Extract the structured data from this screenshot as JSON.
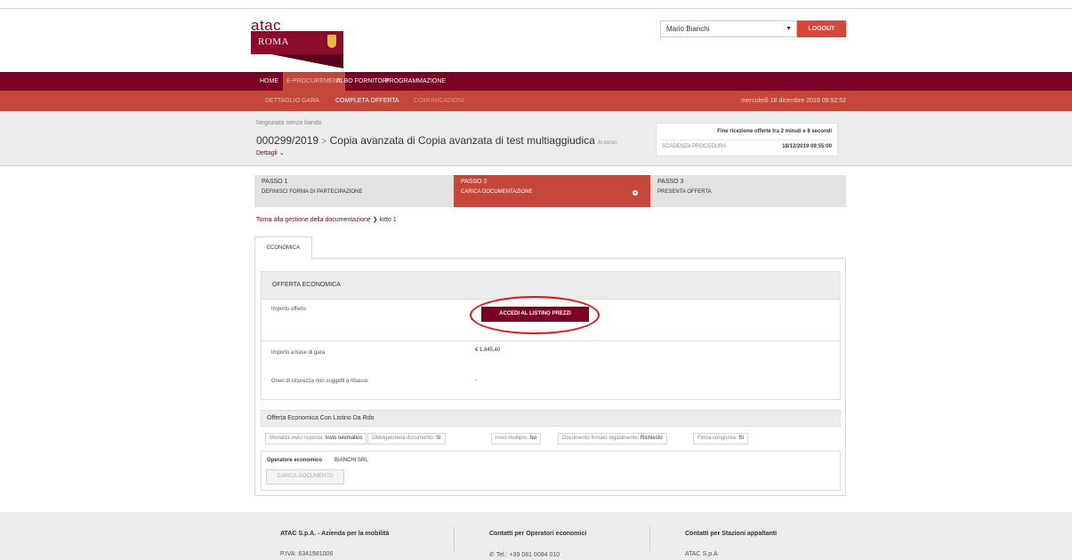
{
  "brand": {
    "word": "atac",
    "sub": "ROMA"
  },
  "user": {
    "name": "Mario Bianchi",
    "logout_label": "LOGOUT"
  },
  "nav": {
    "items": [
      "HOME",
      "E-PROCUREMENT",
      "ALBO FORNITORI",
      "PROGRAMMAZIONE"
    ],
    "active": "E-PROCUREMENT",
    "sub_items": [
      "DETTAGLIO GARA",
      "COMPLETA OFFERTA",
      "COMUNICAZIONI"
    ],
    "date": "mercoledì 18 dicembre 2019 09:52:52"
  },
  "procedure": {
    "type": "Negoziata senza bando",
    "code": "000299/2019",
    "separator": ">",
    "title": "Copia avanzata di Copia avanzata di test multiaggiudica",
    "status": "In corso",
    "details_label": "Dettagli"
  },
  "timer": {
    "message": "Fine ricezione offerte tra 2 minuti e 8 secondi",
    "deadline_label": "SCADENZA PROCEDURA",
    "deadline_value": "18/12/2019 09:55:00"
  },
  "steps": [
    {
      "title": "PASSO 1",
      "subtitle": "DEFINISCI FORMA DI PARTECIPAZIONE"
    },
    {
      "title": "PASSO 2",
      "subtitle": "CARICA DOCUMENTAZIONE"
    },
    {
      "title": "PASSO 3",
      "subtitle": "PRESENTA OFFERTA"
    }
  ],
  "breadcrumb": {
    "link": "Torna alla gestione della documentazione",
    "current": "lotto 1"
  },
  "tab": {
    "label": "ECONOMICA"
  },
  "offer": {
    "header": "OFFERTA ECONOMICA",
    "rows": [
      {
        "label": "Importo offerto",
        "button": "ACCEDI AL LISTINO PREZZI"
      },
      {
        "label": "Importo a base di gara",
        "value": "€ 1.845,40"
      },
      {
        "label": "Oneri di sicurezza non soggetti a ribasso",
        "value": "-"
      }
    ]
  },
  "listino": {
    "header": "Offerta Economica Con Listino Da Rdo",
    "chips": [
      {
        "key": "Modalità invio risposta:",
        "value": "Invio telematico"
      },
      {
        "key": "Obbligatorietà documento:",
        "value": "Sì"
      },
      {
        "key": "Invio multiplo:",
        "value": "No"
      },
      {
        "key": "Documento firmato digitalmente:",
        "value": "Richiesto"
      },
      {
        "key": "Firma congiunta:",
        "value": "Sì"
      }
    ],
    "operator_label": "Operatore economico",
    "operator_value": "BIANCHI SRL",
    "upload_label": "CARICA DOCUMENTO"
  },
  "footer": {
    "cols": [
      {
        "title": "ATAC S.p.A. - Azienda per la mobilità",
        "text": "P.IVA: 6341981006"
      },
      {
        "title": "Contatti per Operatori economici",
        "text": "Tel.: +39 081 0084 010"
      },
      {
        "title": "Contatti per Stazioni appaltanti",
        "text": "ATAC S.p.A"
      }
    ]
  },
  "colors": {
    "maroon": "#7a0026",
    "red": "#c5463a",
    "logout": "#d9473a",
    "highlight": "#e0151b"
  }
}
